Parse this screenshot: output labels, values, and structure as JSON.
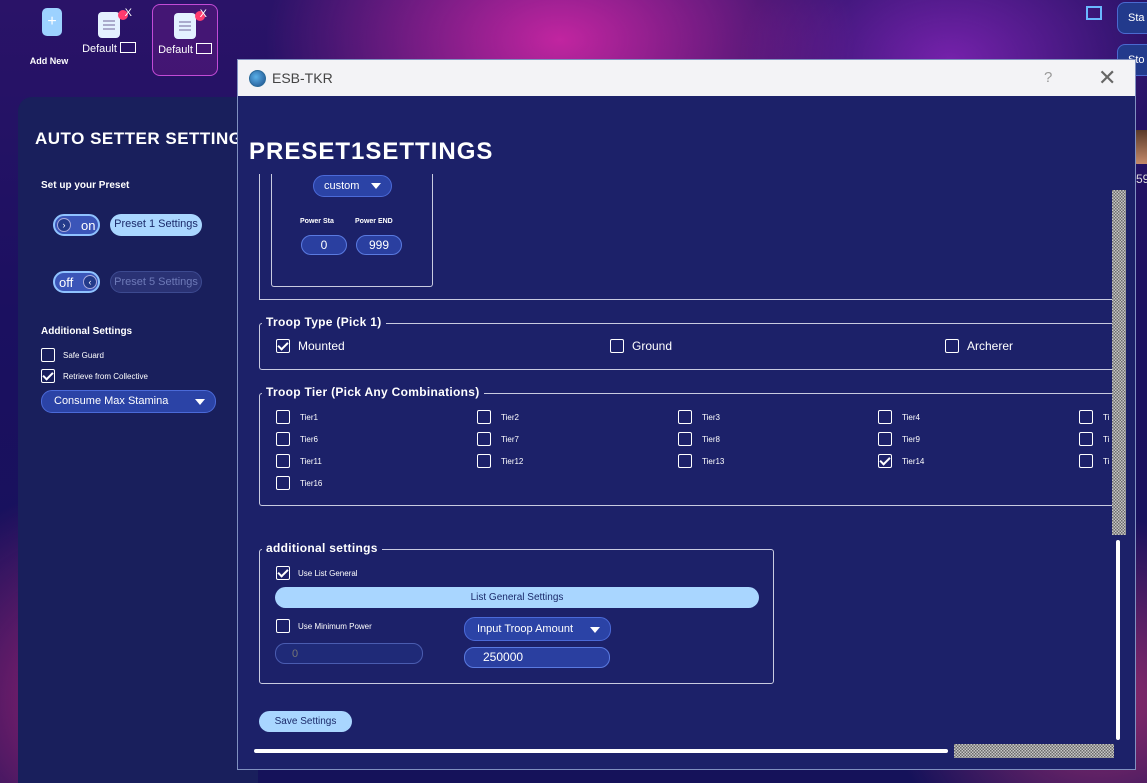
{
  "topbar": {
    "add_new_label": "Add New",
    "add_new_icon": "plus-icon",
    "presets": [
      {
        "name": "Default",
        "close": "X"
      },
      {
        "name": "Default",
        "close": "X"
      }
    ],
    "side_buttons": [
      "Sta",
      "Sto"
    ],
    "avatar_number": "59"
  },
  "left_panel": {
    "title": "AUTO SETTER SETTINGS",
    "setup_label": "Set up your Preset",
    "preset_rows": [
      {
        "toggle": "on",
        "button": "Preset 1 Settings"
      },
      {
        "toggle": "off",
        "button": "Preset 5 Settings"
      }
    ],
    "additional_label": "Additional Settings",
    "checks": [
      {
        "label": "Safe Guard",
        "checked": false
      },
      {
        "label": "Retrieve from Collective",
        "checked": true
      }
    ],
    "stamina_dropdown": "Consume Max Stamina"
  },
  "dialog": {
    "app_title": "ESB-TKR",
    "help": "?",
    "close": "✕",
    "heading": "PRESET1SETTINGS",
    "power": {
      "mode": "custom",
      "sta_label": "Power Sta",
      "end_label": "Power END",
      "sta_value": "0",
      "end_value": "999"
    },
    "troop_type": {
      "legend": "Troop Type (Pick 1)",
      "options": [
        {
          "label": "Mounted",
          "checked": true
        },
        {
          "label": "Ground",
          "checked": false
        },
        {
          "label": "Archerer",
          "checked": false
        }
      ]
    },
    "troop_tier": {
      "legend": "Troop Tier (Pick Any Combinations)",
      "tiers": [
        {
          "label": "Tier1",
          "checked": false
        },
        {
          "label": "Tier2",
          "checked": false
        },
        {
          "label": "Tier3",
          "checked": false
        },
        {
          "label": "Tier4",
          "checked": false
        },
        {
          "label": "Ti",
          "checked": false
        },
        {
          "label": "Tier6",
          "checked": false
        },
        {
          "label": "Tier7",
          "checked": false
        },
        {
          "label": "Tier8",
          "checked": false
        },
        {
          "label": "Tier9",
          "checked": false
        },
        {
          "label": "Ti",
          "checked": false
        },
        {
          "label": "Tier11",
          "checked": false
        },
        {
          "label": "Tier12",
          "checked": false
        },
        {
          "label": "Tier13",
          "checked": false
        },
        {
          "label": "Tier14",
          "checked": true
        },
        {
          "label": "Ti",
          "checked": false
        },
        {
          "label": "Tier16",
          "checked": false
        }
      ]
    },
    "additional": {
      "legend": "additional settings",
      "use_list_general": "Use List General",
      "use_list_general_checked": true,
      "list_general_button": "List General Settings",
      "use_min_power": "Use Minimum Power",
      "use_min_power_checked": false,
      "min_power_placeholder": "0",
      "troop_amount_dropdown": "Input Troop Amount",
      "troop_amount_value": "250000"
    },
    "save_button": "Save Settings"
  }
}
